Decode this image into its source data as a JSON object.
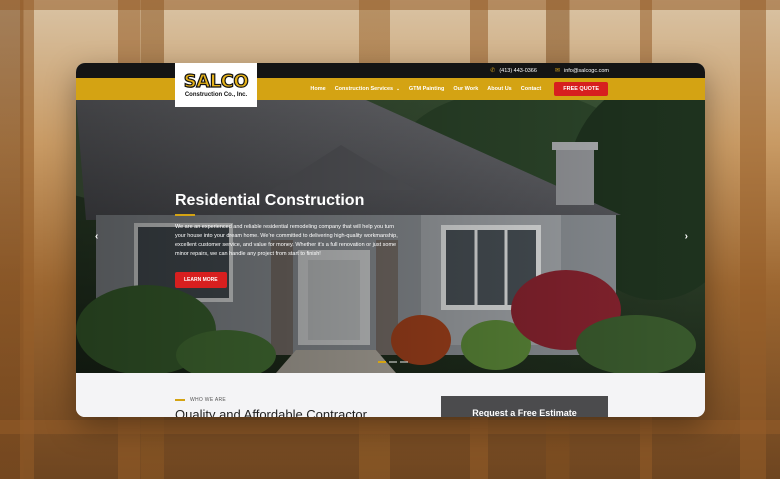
{
  "topbar": {
    "phone": "(413) 443-0366",
    "phone_icon": "phone-icon",
    "email": "info@salcogc.com",
    "email_icon": "email-icon"
  },
  "logo": {
    "word": "SALCO",
    "subtitle": "Construction Co., Inc."
  },
  "nav": {
    "items": [
      {
        "label": "Home"
      },
      {
        "label": "Construction Services",
        "has_dropdown": true
      },
      {
        "label": "GTM Painting"
      },
      {
        "label": "Our Work"
      },
      {
        "label": "About Us"
      },
      {
        "label": "Contact"
      }
    ],
    "quote_label": "FREE QUOTE"
  },
  "hero": {
    "title": "Residential Construction",
    "description": "We are an experienced and reliable residential remodeling company that will help you turn your house into your dream home. We’re committed to delivering high-quality workmanship, excellent customer service, and value for money. Whether it’s a full renovation or just some minor repairs, we can handle any project from start to finish!",
    "button_label": "LEARN MORE",
    "prev_icon": "chevron-left-icon",
    "next_icon": "chevron-right-icon",
    "slides": 3,
    "active_slide": 1
  },
  "about": {
    "eyebrow": "WHO WE ARE",
    "title": "Quality and Affordable Contractor"
  },
  "estimate": {
    "title": "Request a Free Estimate"
  },
  "colors": {
    "brand_yellow": "#d4a313",
    "accent_red": "#d71f1f",
    "topbar_bg": "#141414"
  }
}
